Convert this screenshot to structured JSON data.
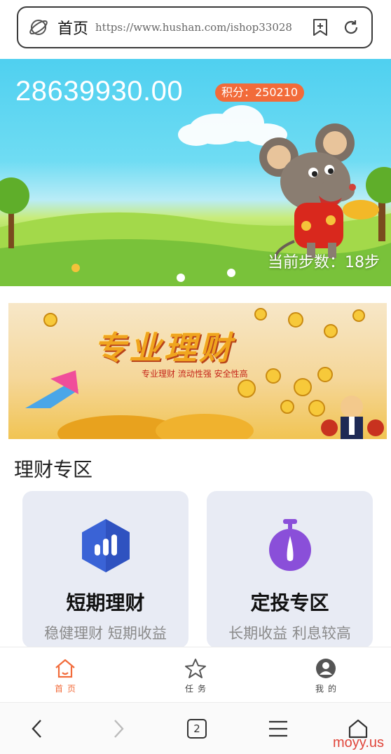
{
  "browser": {
    "tab_title": "首页",
    "url": "https://www.hushan.com/ishop33028",
    "tab_count": "2"
  },
  "hero": {
    "balance": "28639930.00",
    "points_label": "积分：250210",
    "steps_label": "当前步数：18步"
  },
  "banner": {
    "title": "专业理财",
    "subtitle": "专业理财   流动性强   安全性高"
  },
  "section": {
    "title": "理财专区",
    "cards": [
      {
        "name": "短期理财",
        "desc": "稳健理财 短期收益",
        "icon": "chart-hexagon-icon",
        "color": "#3a63d6"
      },
      {
        "name": "定投专区",
        "desc": "长期收益 利息较高",
        "icon": "stopwatch-icon",
        "color": "#8a4fd9"
      }
    ]
  },
  "app_nav": {
    "tabs": [
      {
        "label": "首页",
        "icon": "home-icon",
        "active": true
      },
      {
        "label": "任务",
        "icon": "star-icon",
        "active": false
      },
      {
        "label": "我的",
        "icon": "user-icon",
        "active": false
      }
    ]
  },
  "watermark": "moyy.us",
  "colors": {
    "accent": "#f26b3a",
    "card_bg": "#e8ebf4"
  }
}
